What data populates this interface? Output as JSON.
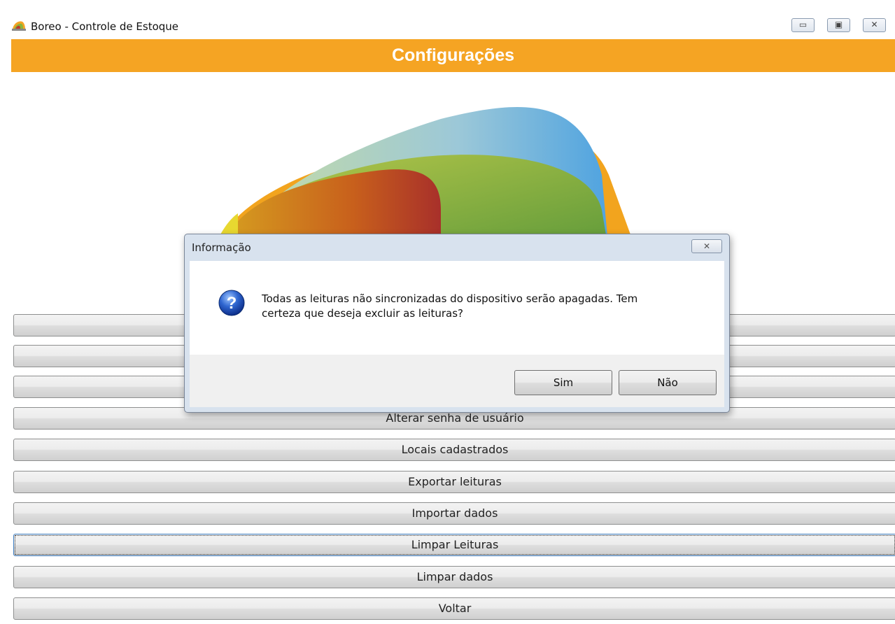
{
  "window": {
    "title": "Boreo - Controle de Estoque",
    "controls": {
      "minimize": "▭",
      "maximize": "▣",
      "close": "✕"
    }
  },
  "header": {
    "title": "Configurações",
    "color": "#f5a423"
  },
  "buttons": [
    {
      "label": ""
    },
    {
      "label": ""
    },
    {
      "label": ""
    },
    {
      "label": "Alterar senha de usuário"
    },
    {
      "label": "Locais cadastrados"
    },
    {
      "label": "Exportar leituras"
    },
    {
      "label": "Importar dados"
    },
    {
      "label": "Limpar Leituras",
      "focused": true
    },
    {
      "label": "Limpar dados"
    },
    {
      "label": "Voltar"
    }
  ],
  "dialog": {
    "title": "Informação",
    "close": "✕",
    "icon": "question-icon",
    "message_line1": "Todas as leituras não sincronizadas do dispositivo serão apagadas. Tem",
    "message_line2": "certeza que deseja excluir as leituras?",
    "yes_label": "Sim",
    "no_label": "Não"
  }
}
